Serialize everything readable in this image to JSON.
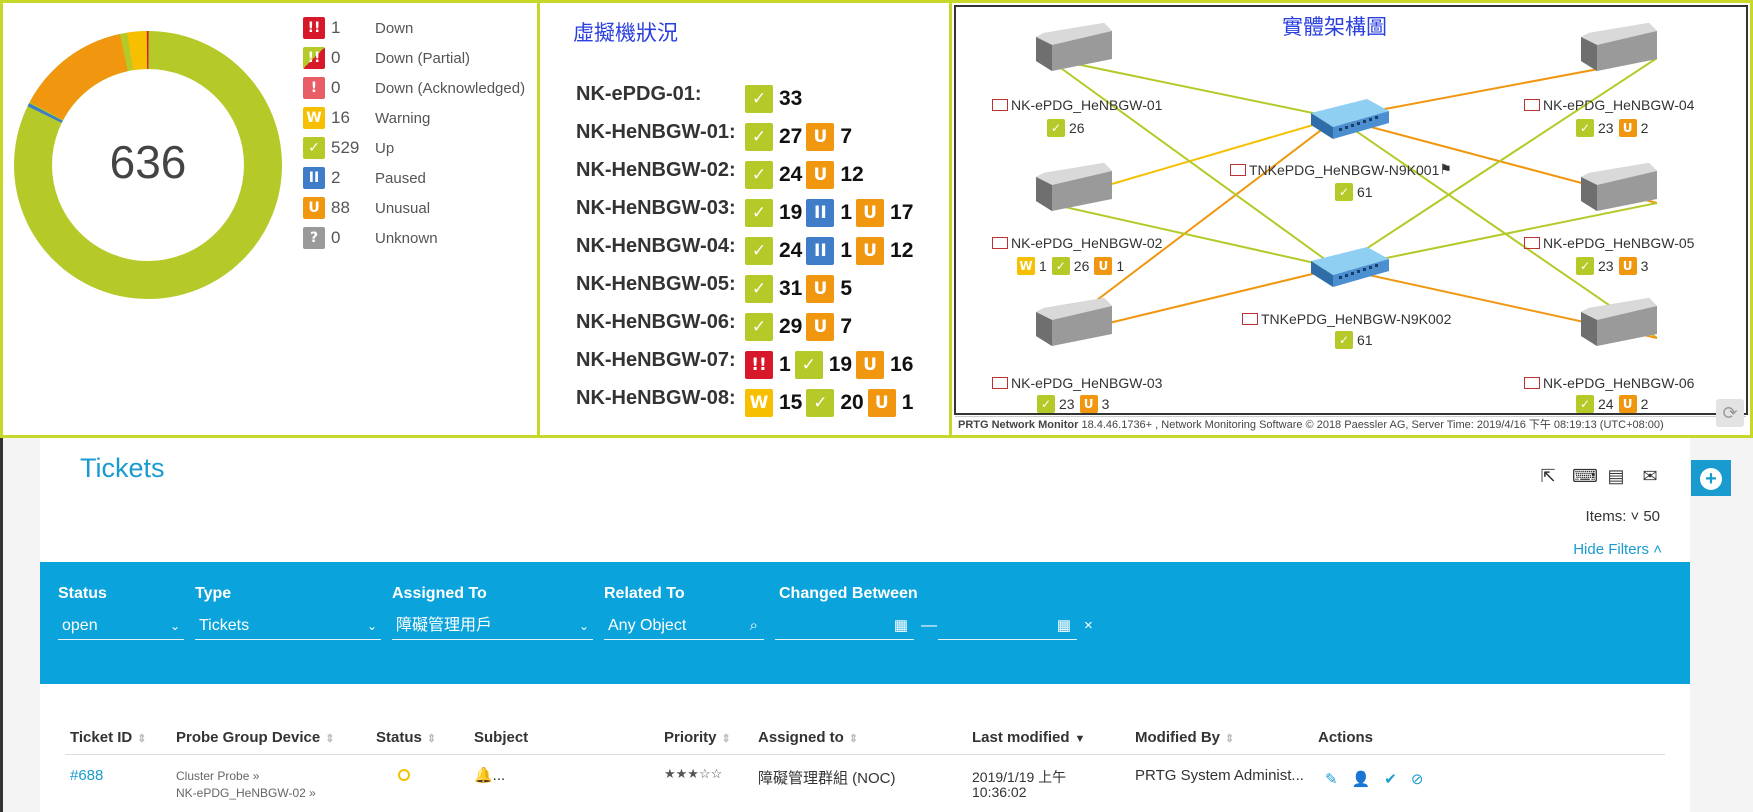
{
  "summary": {
    "total": "636",
    "legend": [
      {
        "badge": "!!",
        "count": "1",
        "label": "Down",
        "cls": "b-down"
      },
      {
        "badge": "!!",
        "count": "0",
        "label": "Down (Partial)",
        "cls": "b-partial"
      },
      {
        "badge": "!",
        "count": "0",
        "label": "Down (Acknowledged)",
        "cls": "b-ack"
      },
      {
        "badge": "W",
        "count": "16",
        "label": "Warning",
        "cls": "b-warn"
      },
      {
        "badge": "✓",
        "count": "529",
        "label": "Up",
        "cls": "b-up"
      },
      {
        "badge": "II",
        "count": "2",
        "label": "Paused",
        "cls": "b-pause"
      },
      {
        "badge": "U",
        "count": "88",
        "label": "Unusual",
        "cls": "b-unusual"
      },
      {
        "badge": "?",
        "count": "0",
        "label": "Unknown",
        "cls": "b-unknown"
      }
    ],
    "colors": {
      "down": "#d7182a",
      "warning": "#f6c000",
      "up": "#b5c928",
      "paused": "#3f7dc8",
      "unusual": "#f0960f"
    }
  },
  "vm_status": {
    "title": "虛擬機狀況",
    "rows": [
      {
        "name": "NK-ePDG-01:",
        "items": [
          {
            "cls": "b-up",
            "badge": "✓",
            "num": "33"
          }
        ]
      },
      {
        "name": "NK-HeNBGW-01:",
        "items": [
          {
            "cls": "b-up",
            "badge": "✓",
            "num": "27"
          },
          {
            "cls": "b-unusual",
            "badge": "U",
            "num": "7"
          }
        ]
      },
      {
        "name": "NK-HeNBGW-02:",
        "items": [
          {
            "cls": "b-up",
            "badge": "✓",
            "num": "24"
          },
          {
            "cls": "b-unusual",
            "badge": "U",
            "num": "12"
          }
        ]
      },
      {
        "name": "NK-HeNBGW-03:",
        "items": [
          {
            "cls": "b-up",
            "badge": "✓",
            "num": "19"
          },
          {
            "cls": "b-pause",
            "badge": "II",
            "num": "1"
          },
          {
            "cls": "b-unusual",
            "badge": "U",
            "num": "17"
          }
        ]
      },
      {
        "name": "NK-HeNBGW-04:",
        "items": [
          {
            "cls": "b-up",
            "badge": "✓",
            "num": "24"
          },
          {
            "cls": "b-pause",
            "badge": "II",
            "num": "1"
          },
          {
            "cls": "b-unusual",
            "badge": "U",
            "num": "12"
          }
        ]
      },
      {
        "name": "NK-HeNBGW-05:",
        "items": [
          {
            "cls": "b-up",
            "badge": "✓",
            "num": "31"
          },
          {
            "cls": "b-unusual",
            "badge": "U",
            "num": "5"
          }
        ]
      },
      {
        "name": "NK-HeNBGW-06:",
        "items": [
          {
            "cls": "b-up",
            "badge": "✓",
            "num": "29"
          },
          {
            "cls": "b-unusual",
            "badge": "U",
            "num": "7"
          }
        ]
      },
      {
        "name": "NK-HeNBGW-07:",
        "items": [
          {
            "cls": "b-down",
            "badge": "!!",
            "num": "1"
          },
          {
            "cls": "b-up",
            "badge": "✓",
            "num": "19"
          },
          {
            "cls": "b-unusual",
            "badge": "U",
            "num": "16"
          }
        ]
      },
      {
        "name": "NK-HeNBGW-08:",
        "items": [
          {
            "cls": "b-warn",
            "badge": "W",
            "num": "15"
          },
          {
            "cls": "b-up",
            "badge": "✓",
            "num": "20"
          },
          {
            "cls": "b-unusual",
            "badge": "U",
            "num": "1"
          }
        ]
      }
    ]
  },
  "topology": {
    "title": "實體架構圖",
    "nodes": [
      {
        "id": "n1",
        "label": "NK-ePDG_HeNBGW-01",
        "stats": [
          {
            "cls": "b-up",
            "badge": "✓",
            "num": "26"
          }
        ]
      },
      {
        "id": "n2",
        "label": "NK-ePDG_HeNBGW-02",
        "stats": [
          {
            "cls": "b-warn",
            "badge": "W",
            "num": "1"
          },
          {
            "cls": "b-up",
            "badge": "✓",
            "num": "26"
          },
          {
            "cls": "b-unusual",
            "badge": "U",
            "num": "1"
          }
        ]
      },
      {
        "id": "n3",
        "label": "NK-ePDG_HeNBGW-03",
        "stats": [
          {
            "cls": "b-up",
            "badge": "✓",
            "num": "23"
          },
          {
            "cls": "b-unusual",
            "badge": "U",
            "num": "3"
          }
        ]
      },
      {
        "id": "n4",
        "label": "NK-ePDG_HeNBGW-04",
        "stats": [
          {
            "cls": "b-up",
            "badge": "✓",
            "num": "23"
          },
          {
            "cls": "b-unusual",
            "badge": "U",
            "num": "2"
          }
        ]
      },
      {
        "id": "n5",
        "label": "NK-ePDG_HeNBGW-05",
        "stats": [
          {
            "cls": "b-up",
            "badge": "✓",
            "num": "23"
          },
          {
            "cls": "b-unusual",
            "badge": "U",
            "num": "3"
          }
        ]
      },
      {
        "id": "n6",
        "label": "NK-ePDG_HeNBGW-06",
        "stats": [
          {
            "cls": "b-up",
            "badge": "✓",
            "num": "24"
          },
          {
            "cls": "b-unusual",
            "badge": "U",
            "num": "2"
          }
        ]
      },
      {
        "id": "s1",
        "label": "TNKePDG_HeNBGW-N9K001",
        "stats": [
          {
            "cls": "b-up",
            "badge": "✓",
            "num": "61"
          }
        ]
      },
      {
        "id": "s2",
        "label": "TNKePDG_HeNBGW-N9K002",
        "stats": [
          {
            "cls": "b-up",
            "badge": "✓",
            "num": "61"
          }
        ]
      }
    ],
    "footer_brand": "PRTG Network Monitor",
    "footer_rest": " 18.4.46.1736+ , Network Monitoring Software © 2018 Paessler AG, Server Time: 2019/4/16 下午 08:19:13 (UTC+08:00)"
  },
  "tickets": {
    "title": "Tickets",
    "items_label": "Items:",
    "items_value": "50",
    "hide_filters": "Hide Filters",
    "filters": {
      "status_label": "Status",
      "status_value": "open",
      "type_label": "Type",
      "type_value": "Tickets",
      "assigned_label": "Assigned To",
      "assigned_value": "障礙管理用戶",
      "related_label": "Related To",
      "related_placeholder": "Any Object",
      "changed_label": "Changed Between",
      "dash": "—",
      "clear": "×"
    },
    "columns": [
      "Ticket ID",
      "Probe Group Device",
      "Status",
      "Subject",
      "Priority",
      "Assigned to",
      "Last modified",
      "Modified By",
      "Actions"
    ],
    "rows": [
      {
        "id": "#688",
        "probe": "Cluster Probe »",
        "device": "NK-ePDG_HeNBGW-02 »",
        "subject": "🔔...",
        "priority": "★★★☆☆",
        "assigned": "障礙管理群組 (NOC)",
        "modified_date": "2019/1/19 上午",
        "modified_time": "10:36:02",
        "modified_by": "PRTG System Administ..."
      }
    ]
  }
}
